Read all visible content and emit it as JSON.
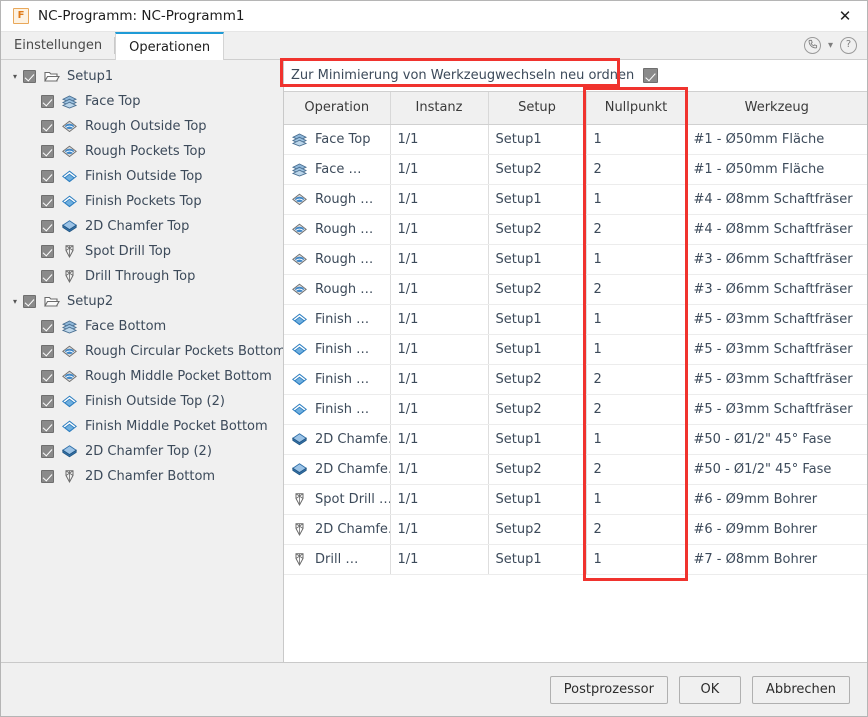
{
  "window": {
    "title": "NC-Programm: NC-Programm1",
    "app_icon": "fusion-f-icon",
    "close_label": "✕"
  },
  "tabs": [
    {
      "label": "Einstellungen",
      "active": false,
      "name": "tab-einstellungen"
    },
    {
      "label": "Operationen",
      "active": true,
      "name": "tab-operationen"
    }
  ],
  "tab_icons": {
    "phone": "✆",
    "chevron": "▾",
    "help": "?"
  },
  "tree": [
    {
      "label": "Setup1",
      "level": 0,
      "icon": "setup-folder-icon",
      "checked": true,
      "expanded": true
    },
    {
      "label": "Face Top",
      "level": 1,
      "icon": "face-icon",
      "checked": true
    },
    {
      "label": "Rough Outside Top",
      "level": 1,
      "icon": "adaptive-clearing-icon",
      "checked": true
    },
    {
      "label": "Rough Pockets Top",
      "level": 1,
      "icon": "adaptive-clearing-icon",
      "checked": true
    },
    {
      "label": "Finish Outside Top",
      "level": 1,
      "icon": "contour-icon",
      "checked": true
    },
    {
      "label": "Finish Pockets Top",
      "level": 1,
      "icon": "contour-icon",
      "checked": true
    },
    {
      "label": "2D Chamfer Top",
      "level": 1,
      "icon": "chamfer-icon",
      "checked": true
    },
    {
      "label": "Spot Drill Top",
      "level": 1,
      "icon": "drill-icon",
      "checked": true
    },
    {
      "label": "Drill Through Top",
      "level": 1,
      "icon": "drill-icon",
      "checked": true
    },
    {
      "label": "Setup2",
      "level": 0,
      "icon": "setup-folder-icon",
      "checked": true,
      "expanded": true
    },
    {
      "label": "Face Bottom",
      "level": 1,
      "icon": "face-icon",
      "checked": true
    },
    {
      "label": "Rough Circular Pockets Bottom",
      "level": 1,
      "icon": "adaptive-clearing-icon",
      "checked": true
    },
    {
      "label": "Rough Middle Pocket Bottom",
      "level": 1,
      "icon": "adaptive-clearing-icon",
      "checked": true
    },
    {
      "label": "Finish Outside Top (2)",
      "level": 1,
      "icon": "contour-icon",
      "checked": true
    },
    {
      "label": "Finish Middle Pocket Bottom",
      "level": 1,
      "icon": "contour-icon",
      "checked": true
    },
    {
      "label": "2D Chamfer Top (2)",
      "level": 1,
      "icon": "chamfer-icon",
      "checked": true
    },
    {
      "label": "2D Chamfer Bottom",
      "level": 1,
      "icon": "drill-icon",
      "checked": true
    }
  ],
  "reorder": {
    "label": "Zur Minimierung von Werkzeugwechseln neu ordnen",
    "checked": true
  },
  "table": {
    "headers": [
      "Operation",
      "Instanz",
      "Setup",
      "Nullpunkt",
      "Werkzeug"
    ],
    "rows": [
      {
        "operation": "Face Top",
        "icon": "face-icon",
        "instanz": "1/1",
        "setup": "Setup1",
        "nullpunkt": "1",
        "werkzeug": "#1 - Ø50mm Fläche"
      },
      {
        "operation": "Face …",
        "icon": "face-icon",
        "instanz": "1/1",
        "setup": "Setup2",
        "nullpunkt": "2",
        "werkzeug": "#1 - Ø50mm Fläche"
      },
      {
        "operation": "Rough …",
        "icon": "adaptive-clearing-icon",
        "instanz": "1/1",
        "setup": "Setup1",
        "nullpunkt": "1",
        "werkzeug": "#4 - Ø8mm Schaftfräser"
      },
      {
        "operation": "Rough …",
        "icon": "adaptive-clearing-icon",
        "instanz": "1/1",
        "setup": "Setup2",
        "nullpunkt": "2",
        "werkzeug": "#4 - Ø8mm Schaftfräser"
      },
      {
        "operation": "Rough …",
        "icon": "adaptive-clearing-icon",
        "instanz": "1/1",
        "setup": "Setup1",
        "nullpunkt": "1",
        "werkzeug": "#3 - Ø6mm Schaftfräser"
      },
      {
        "operation": "Rough …",
        "icon": "adaptive-clearing-icon",
        "instanz": "1/1",
        "setup": "Setup2",
        "nullpunkt": "2",
        "werkzeug": "#3 - Ø6mm Schaftfräser"
      },
      {
        "operation": "Finish …",
        "icon": "contour-icon",
        "instanz": "1/1",
        "setup": "Setup1",
        "nullpunkt": "1",
        "werkzeug": "#5 - Ø3mm Schaftfräser"
      },
      {
        "operation": "Finish …",
        "icon": "contour-icon",
        "instanz": "1/1",
        "setup": "Setup1",
        "nullpunkt": "1",
        "werkzeug": "#5 - Ø3mm Schaftfräser"
      },
      {
        "operation": "Finish …",
        "icon": "contour-icon",
        "instanz": "1/1",
        "setup": "Setup2",
        "nullpunkt": "2",
        "werkzeug": "#5 - Ø3mm Schaftfräser"
      },
      {
        "operation": "Finish …",
        "icon": "contour-icon",
        "instanz": "1/1",
        "setup": "Setup2",
        "nullpunkt": "2",
        "werkzeug": "#5 - Ø3mm Schaftfräser"
      },
      {
        "operation": "2D Chamfe…",
        "icon": "chamfer-icon",
        "instanz": "1/1",
        "setup": "Setup1",
        "nullpunkt": "1",
        "werkzeug": "#50 - Ø1/2\" 45° Fase"
      },
      {
        "operation": "2D Chamfe…",
        "icon": "chamfer-icon",
        "instanz": "1/1",
        "setup": "Setup2",
        "nullpunkt": "2",
        "werkzeug": "#50 - Ø1/2\" 45° Fase"
      },
      {
        "operation": "Spot Drill …",
        "icon": "drill-icon",
        "instanz": "1/1",
        "setup": "Setup1",
        "nullpunkt": "1",
        "werkzeug": "#6 - Ø9mm Bohrer"
      },
      {
        "operation": "2D Chamfe…",
        "icon": "drill-icon",
        "instanz": "1/1",
        "setup": "Setup2",
        "nullpunkt": "2",
        "werkzeug": "#6 - Ø9mm Bohrer"
      },
      {
        "operation": "Drill …",
        "icon": "drill-icon",
        "instanz": "1/1",
        "setup": "Setup1",
        "nullpunkt": "1",
        "werkzeug": "#7 - Ø8mm Bohrer"
      }
    ]
  },
  "footer": {
    "postprocessor": "Postprozessor",
    "ok": "OK",
    "cancel": "Abbrechen"
  },
  "annotations": {
    "highlight_color": "#f0332e"
  }
}
